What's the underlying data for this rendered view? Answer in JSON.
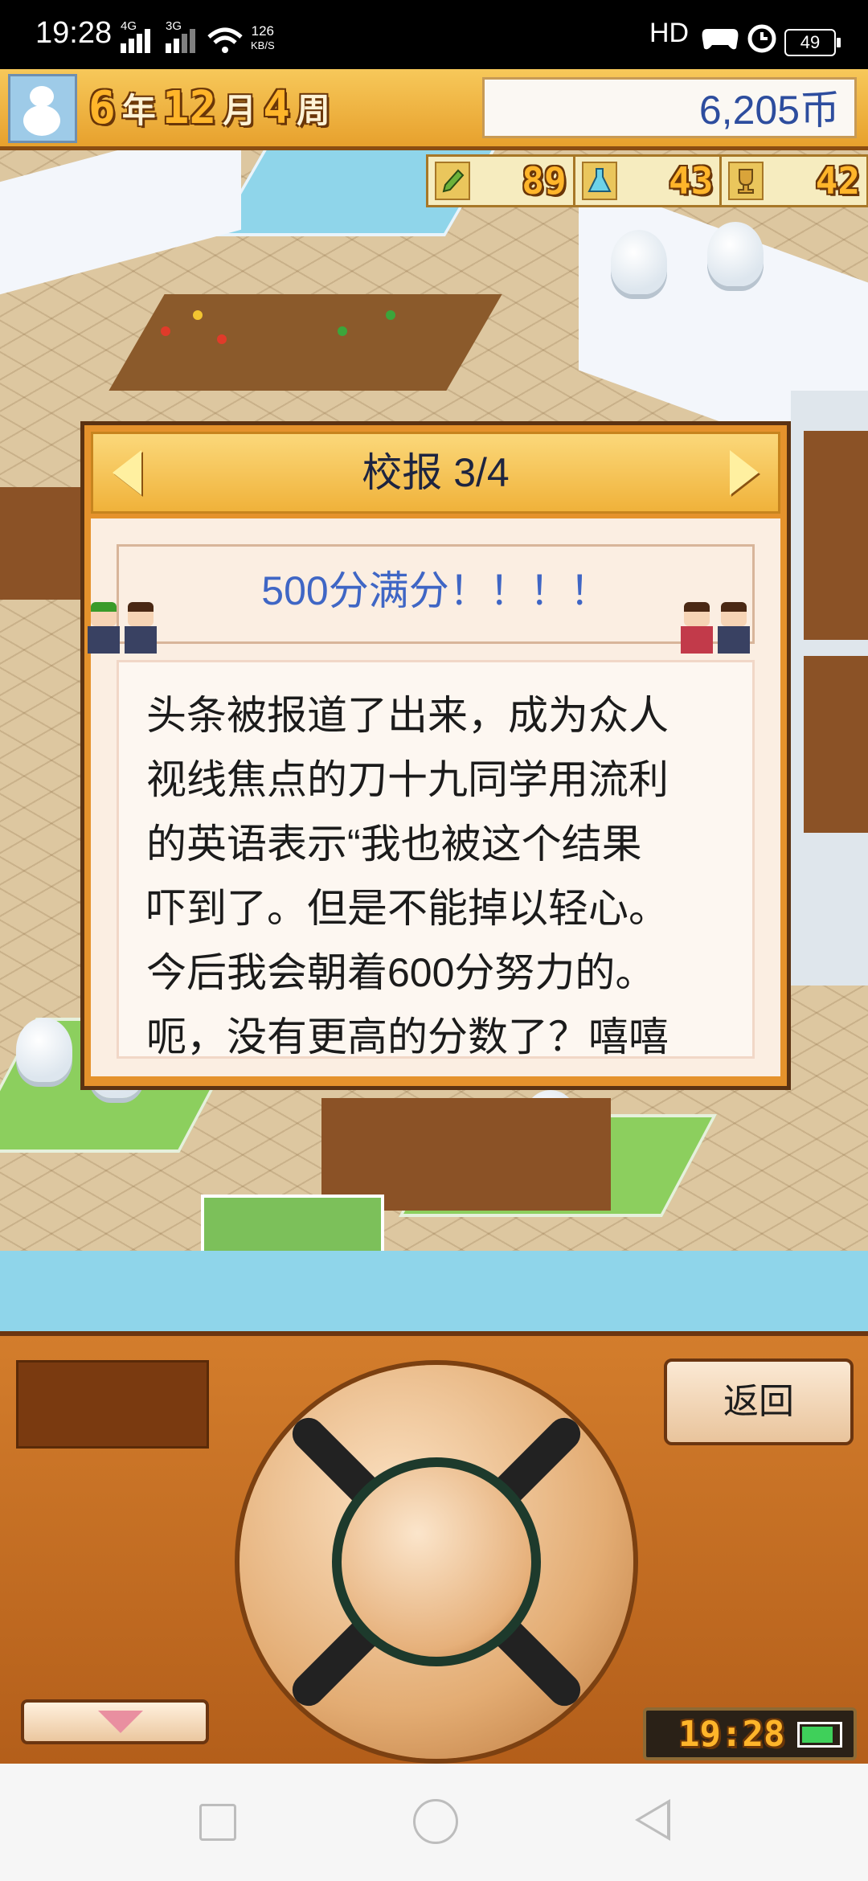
{
  "status_bar": {
    "time": "19:28",
    "signal1_label": "4G",
    "signal2_label": "3G",
    "net_speed": "126",
    "net_unit": "KB/S",
    "hd_label": "HD",
    "battery_level": "49"
  },
  "hud": {
    "year_num": "6",
    "year_unit": "年",
    "month_num": "12",
    "month_unit": "月",
    "week_num": "4",
    "week_unit": "周",
    "money": "6,205币",
    "stats": [
      {
        "icon": "pencil-icon",
        "value": "89"
      },
      {
        "icon": "flask-icon",
        "value": "43"
      },
      {
        "icon": "trophy-icon",
        "value": "42"
      }
    ]
  },
  "dialog": {
    "title": "校报 3/4",
    "headline": "500分满分！！！！",
    "article_lines": [
      "头条被报道了出来，成为众人",
      "视线焦点的刀十九同学用流利",
      "的英语表示“我也被这个结果",
      "吓到了。但是不能掉以轻心。",
      "今后我会朝着600分努力的。",
      "呃，没有更高的分数了？嘻嘻"
    ]
  },
  "controller": {
    "back_label": "返回",
    "clock_time": "19:28"
  },
  "colors": {
    "accent_orange": "#e5922c",
    "headline_blue": "#3f66c5",
    "money_blue": "#2d4d9e",
    "pixel_gold": "#ffb52a"
  }
}
